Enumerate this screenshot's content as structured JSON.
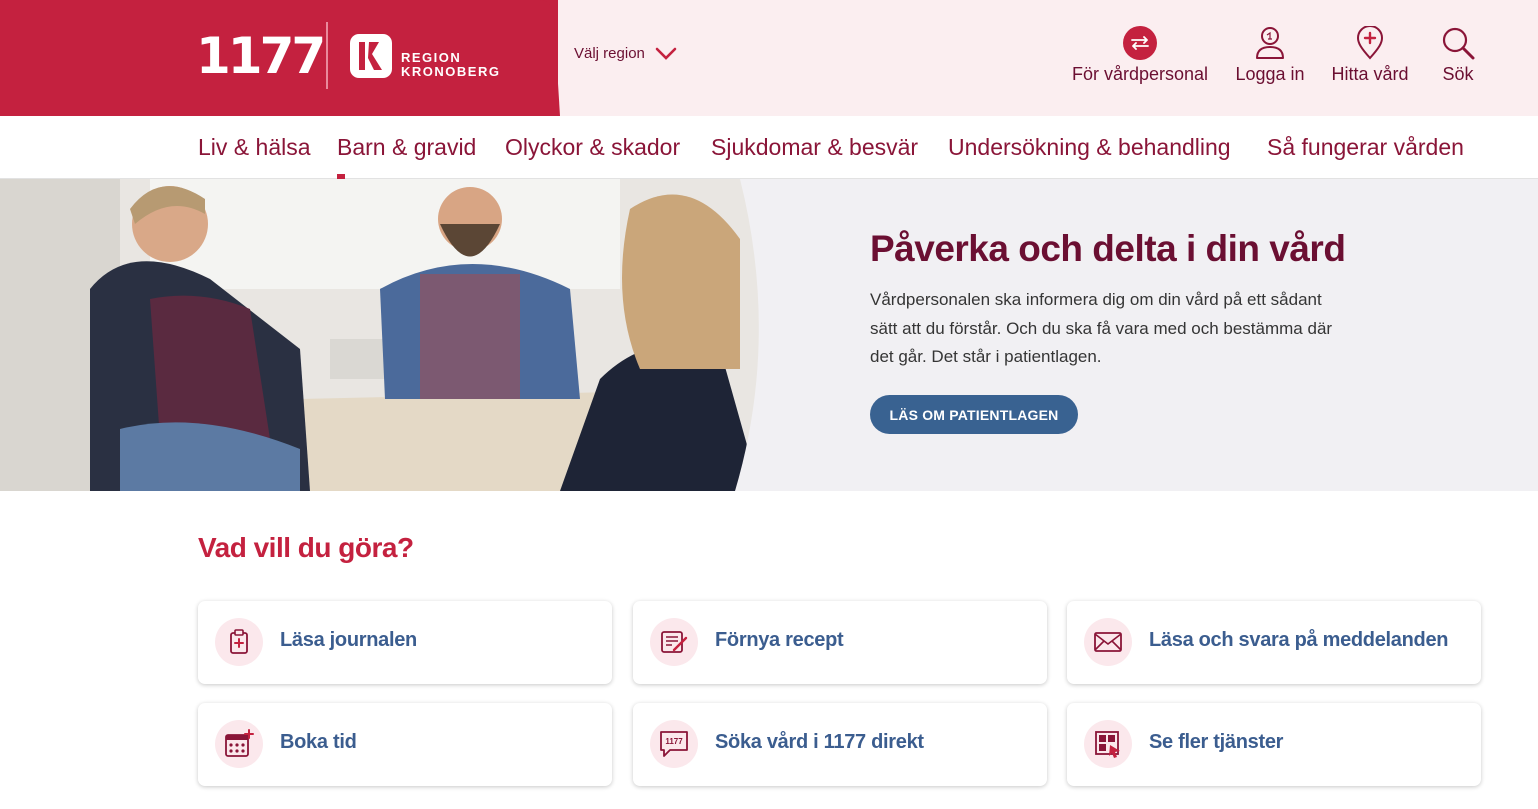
{
  "header": {
    "logo_text": "1177",
    "region_logo_line1": "REGION",
    "region_logo_line2": "KRONOBERG",
    "region_select_label": "Välj region",
    "tools": [
      {
        "label": "För vårdpersonal",
        "icon": "swap-arrows-icon"
      },
      {
        "label": "Logga in",
        "icon": "user-icon"
      },
      {
        "label": "Hitta vård",
        "icon": "location-pin-cross-icon"
      },
      {
        "label": "Sök",
        "icon": "search-icon"
      }
    ]
  },
  "nav": {
    "items": [
      {
        "label": "Liv & hälsa"
      },
      {
        "label": "Barn & gravid",
        "active": true
      },
      {
        "label": "Olyckor & skador"
      },
      {
        "label": "Sjukdomar & besvär"
      },
      {
        "label": "Undersökning & behandling"
      },
      {
        "label": "Så fungerar vården"
      }
    ]
  },
  "hero": {
    "title": "Påverka och delta i din vård",
    "text": "Vårdpersonalen ska informera dig om din vård på ett sådant sätt att du förstår. Och du ska få vara med och bestämma där det går. Det står i patientlagen.",
    "button_label": "LÄS OM PATIENTLAGEN"
  },
  "services": {
    "title": "Vad vill du göra?",
    "items": [
      {
        "label": "Läsa journalen",
        "icon": "clipboard-cross-icon"
      },
      {
        "label": "Förnya recept",
        "icon": "prescription-pen-icon"
      },
      {
        "label": "Läsa och svara på meddelanden",
        "icon": "envelope-icon"
      },
      {
        "label": "Boka tid",
        "icon": "calendar-plus-icon"
      },
      {
        "label": "Söka vård i 1177 direkt",
        "icon": "chat-1177-icon"
      },
      {
        "label": "Se fler tjänster",
        "icon": "grid-cursor-icon"
      }
    ]
  },
  "colors": {
    "brand_red": "#c4213f",
    "brand_wine": "#6b0f32",
    "header_pink": "#fbeef0",
    "button_blue": "#396291",
    "card_text_blue": "#3b5d8f"
  }
}
